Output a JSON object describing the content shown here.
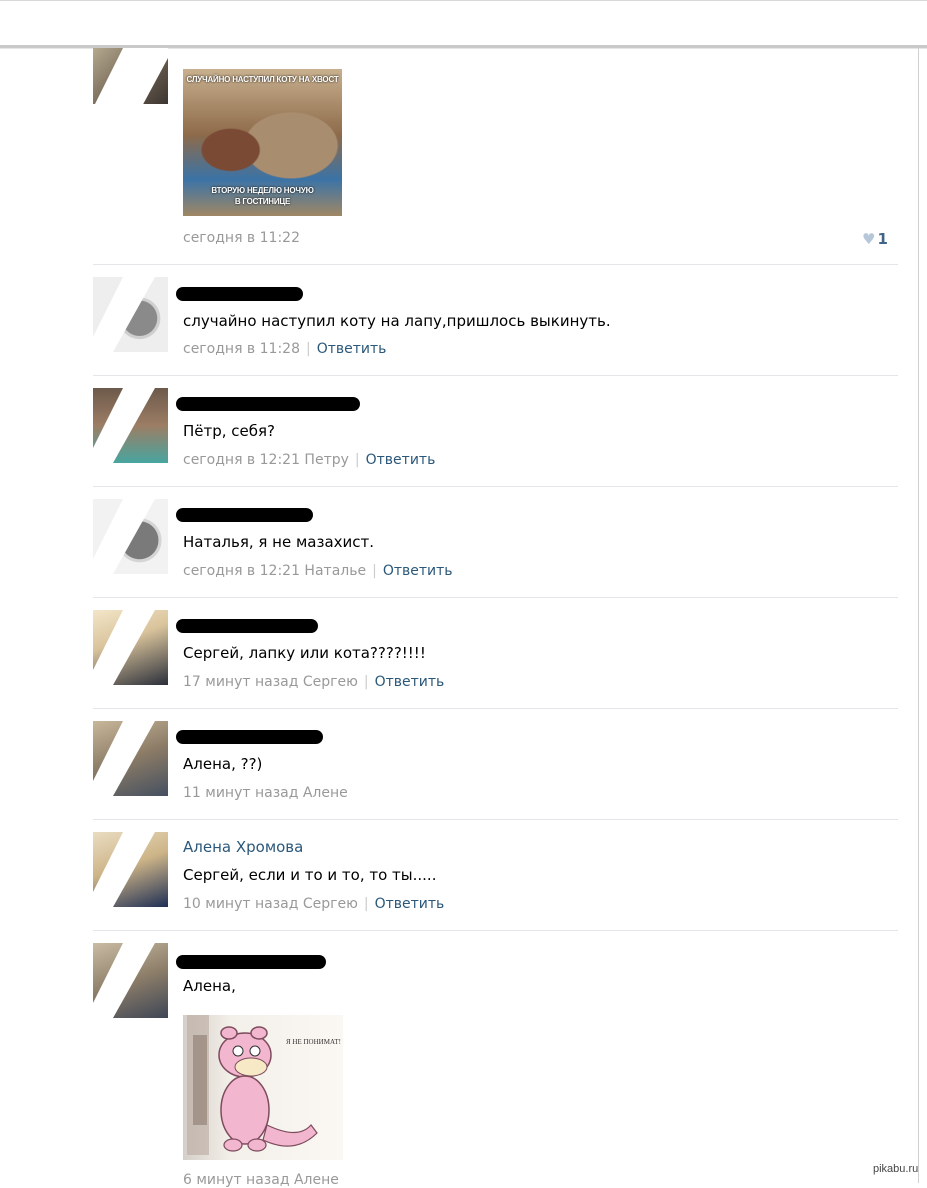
{
  "comments": [
    {
      "id": "c0",
      "photo_caption_top": "СЛУЧАЙНО НАСТУПИЛ КОТУ НА ХВОСТ",
      "photo_caption_bottom_1": "ВТОРУЮ НЕДЕЛЮ НОЧУЮ",
      "photo_caption_bottom_2": "В ГОСТИНИЦЕ",
      "time": "сегодня в 11:22",
      "likes": "1"
    },
    {
      "id": "c1",
      "text": "случайно наступил коту на лапу,пришлось выкинуть.",
      "time": "сегодня в 11:28",
      "reply_label": "Ответить"
    },
    {
      "id": "c2",
      "text": "Пётр, себя?",
      "time": "сегодня в 12:21 Петру",
      "reply_label": "Ответить"
    },
    {
      "id": "c3",
      "text": "Наталья, я не мазахист.",
      "time": "сегодня в 12:21 Наталье",
      "reply_label": "Ответить"
    },
    {
      "id": "c4",
      "text": "Сергей, лапку или кота????!!!!",
      "time": "17 минут назад Сергею",
      "reply_label": "Ответить"
    },
    {
      "id": "c5",
      "text": "Алена, ??)",
      "time": "11 минут назад Алене"
    },
    {
      "id": "c6",
      "author": "Алена Хромова",
      "text": "Сергей, если и то и то, то ты.....",
      "time": "10 минут назад Сергею",
      "reply_label": "Ответить"
    },
    {
      "id": "c7",
      "text": "Алена,",
      "photo_caption": "Я НЕ ПОНИМАТ!",
      "time": "6 минут назад Алене"
    }
  ],
  "watermark": "pikabu.ru"
}
